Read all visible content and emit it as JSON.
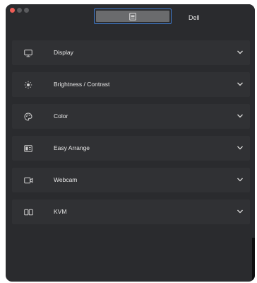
{
  "titlebar": {
    "monitor_brand": "Dell",
    "monitor_tab_icon": "document-list-icon"
  },
  "colors": {
    "window_bg": "#2a2b2e",
    "row_bg": "#303134",
    "accent": "#3f79c9",
    "text": "#e8e8e8",
    "close": "#ee5d56"
  },
  "sections": [
    {
      "label": "Display",
      "icon": "monitor-icon"
    },
    {
      "label": "Brightness / Contrast",
      "icon": "sun-icon"
    },
    {
      "label": "Color",
      "icon": "palette-icon"
    },
    {
      "label": "Easy Arrange",
      "icon": "window-layout-icon"
    },
    {
      "label": "Webcam",
      "icon": "webcam-icon"
    },
    {
      "label": "KVM",
      "icon": "kvm-icon"
    }
  ]
}
